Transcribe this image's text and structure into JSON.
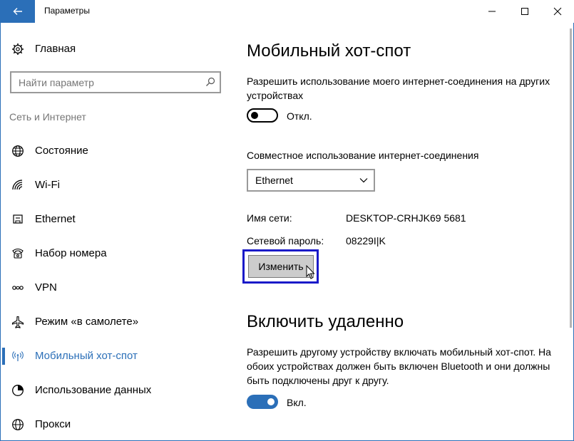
{
  "window": {
    "title": "Параметры",
    "accent": "#2b6fb8"
  },
  "titlebar": {
    "back_icon": "back-arrow-icon",
    "minimize_icon": "minimize-icon",
    "maximize_icon": "maximize-icon",
    "close_icon": "close-icon"
  },
  "sidebar": {
    "home_label": "Главная",
    "search_placeholder": "Найти параметр",
    "section_title": "Сеть и Интернет",
    "items": [
      {
        "label": "Состояние",
        "icon": "globe-status-icon",
        "active": false
      },
      {
        "label": "Wi-Fi",
        "icon": "wifi-icon",
        "active": false
      },
      {
        "label": "Ethernet",
        "icon": "ethernet-icon",
        "active": false
      },
      {
        "label": "Набор номера",
        "icon": "dialup-phone-icon",
        "active": false
      },
      {
        "label": "VPN",
        "icon": "vpn-icon",
        "active": false
      },
      {
        "label": "Режим «в самолете»",
        "icon": "airplane-icon",
        "active": false
      },
      {
        "label": "Мобильный хот-спот",
        "icon": "hotspot-icon",
        "active": true
      },
      {
        "label": "Использование данных",
        "icon": "data-usage-icon",
        "active": false
      },
      {
        "label": "Прокси",
        "icon": "proxy-globe-icon",
        "active": false
      }
    ]
  },
  "hotspot": {
    "title": "Мобильный хот-спот",
    "share_desc": "Разрешить использование моего интернет-соединения на других устройствах",
    "share_toggle_state": "off",
    "share_toggle_label": "Откл.",
    "share_from_label": "Совместное использование интернет-соединения",
    "share_from_value": "Ethernet",
    "network_name_label": "Имя сети:",
    "network_name_value": "DESKTOP-CRHJK69 5681",
    "password_label": "Сетевой пароль:",
    "password_value": "08229I|K",
    "edit_button": "Изменить"
  },
  "remote": {
    "title": "Включить удаленно",
    "desc": "Разрешить другому устройству включать мобильный хот-спот. На обоих устройствах должен быть включен Bluetooth и они должны быть подключены друг к другу.",
    "toggle_state": "on",
    "toggle_label": "Вкл."
  }
}
